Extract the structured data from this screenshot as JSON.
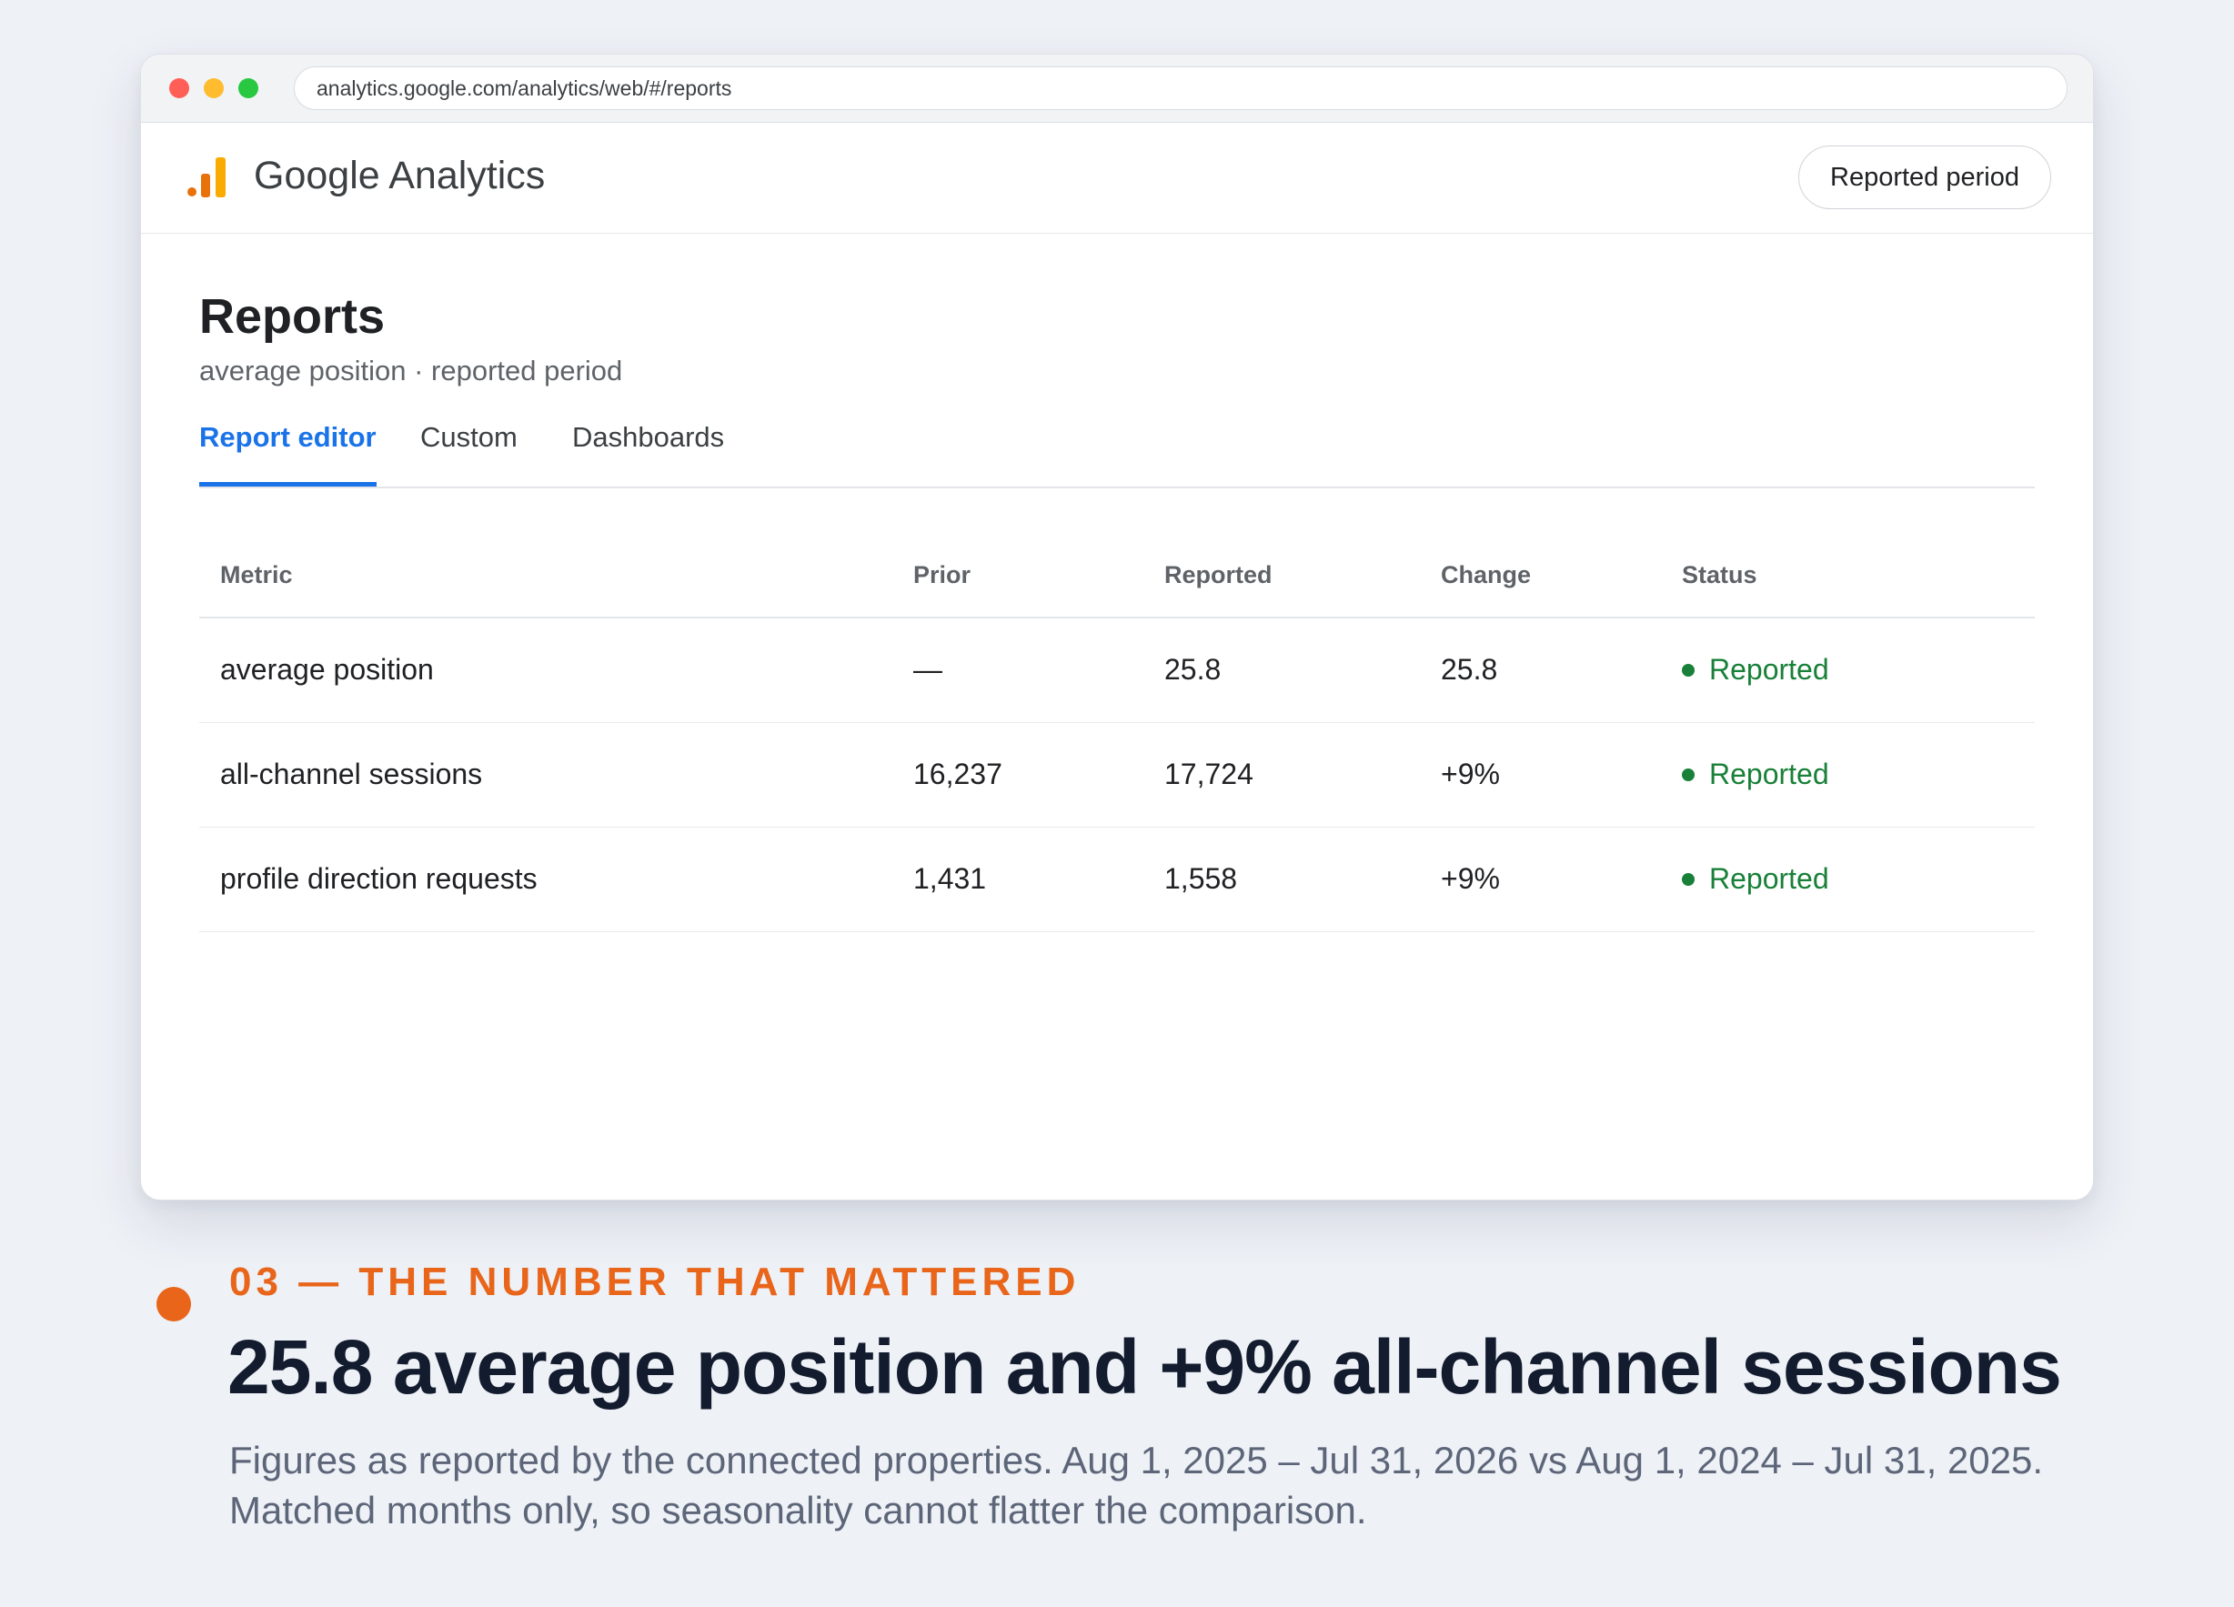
{
  "browser": {
    "url": "analytics.google.com/analytics/web/#/reports"
  },
  "app": {
    "title": "Google Analytics",
    "period_button": "Reported period",
    "colors": {
      "accent": "#1a73e8",
      "logo_orange": "#e8710a",
      "logo_amber": "#f9ab00",
      "status_green": "#188038"
    }
  },
  "page": {
    "title": "Reports",
    "subtitle": "average position · reported period",
    "tabs": [
      {
        "label": "Report editor",
        "active": true
      },
      {
        "label": "Custom",
        "active": false
      },
      {
        "label": "Dashboards",
        "active": false
      }
    ]
  },
  "table": {
    "headers": [
      "Metric",
      "Prior",
      "Reported",
      "Change",
      "Status"
    ],
    "rows": [
      {
        "metric": "average position",
        "prior": "—",
        "reported": "25.8",
        "change": "25.8",
        "status": "Reported"
      },
      {
        "metric": "all-channel sessions",
        "prior": "16,237",
        "reported": "17,724",
        "change": "+9%",
        "status": "Reported"
      },
      {
        "metric": "profile direction requests",
        "prior": "1,431",
        "reported": "1,558",
        "change": "+9%",
        "status": "Reported"
      }
    ]
  },
  "caption": {
    "eyebrow": "03 — THE NUMBER THAT MATTERED",
    "headline": "25.8 average position and +9% all-channel sessions",
    "body": "Figures as reported by the connected properties. Aug 1, 2025 – Jul 31, 2026 vs Aug 1, 2024 – Jul 31, 2025. Matched months only, so seasonality cannot flatter the comparison.",
    "accent_color": "#e8651a"
  }
}
